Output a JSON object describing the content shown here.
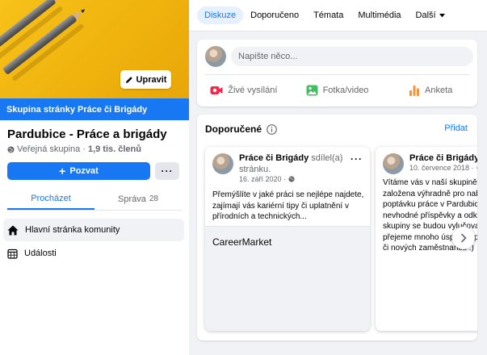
{
  "cover": {
    "edit_label": "Upravit"
  },
  "banner": {
    "text": "Skupina stránky Práce či Brigády"
  },
  "group": {
    "name": "Pardubice - Práce a brigády",
    "privacy": "Veřejná skupina",
    "separator": " · ",
    "members": "1,9 tis. členů",
    "invite_label": "Pozvat",
    "more_label": "···"
  },
  "left_tabs": [
    {
      "label": "Procházet",
      "count": ""
    },
    {
      "label": "Správa",
      "count": "28"
    }
  ],
  "left_nav": [
    {
      "label": "Hlavní stránka komunity",
      "icon": "home-icon"
    },
    {
      "label": "Události",
      "icon": "calendar-icon"
    }
  ],
  "top_nav": {
    "items": [
      "Diskuze",
      "Doporučeno",
      "Témata",
      "Multimédia",
      "Další"
    ],
    "active": "Diskuze"
  },
  "composer": {
    "placeholder": "Napište něco...",
    "actions": [
      "Živé vysílání",
      "Fotka/video",
      "Anketa"
    ]
  },
  "recommended": {
    "title": "Doporučené",
    "add_label": "Přidat",
    "cards": [
      {
        "author": "Práce či Brigády",
        "shared": " sdílel(a) stránku.",
        "date": "16. září 2020 ·",
        "text": "Přemýšlíte v jaké práci se nejlépe najdete, zajímají vás kariérní tipy či uplatnění v přírodních a technických...",
        "link_title": "CareerMarket"
      },
      {
        "author": "Práce či Brigády",
        "shared": "",
        "date": "10. července 2018 ·",
        "text": "Vítáme vás v naší skupině, která je založena výhradně pro nabídky a poptávku práce v Pardubicích a okolí. Za nevhodné příspěvky a odkazy na jiné skupiny se budou vylučovat. Všem přejeme mnoho úspěchů při hledání práce či nových zaměstnanců :)",
        "link_title": ""
      }
    ]
  },
  "colors": {
    "accent": "#1877f2",
    "cover": "#f7c21a"
  }
}
